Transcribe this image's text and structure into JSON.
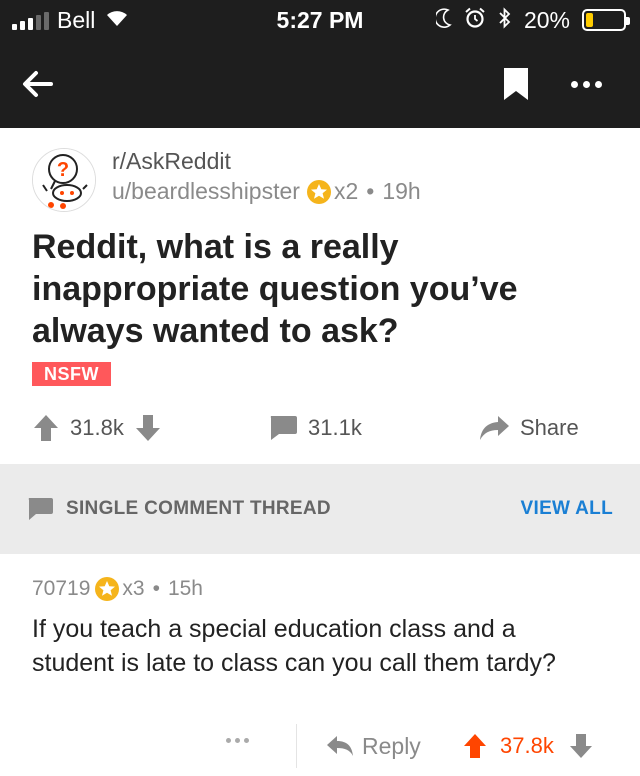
{
  "status_bar": {
    "carrier": "Bell",
    "time": "5:27 PM",
    "battery_percent": "20%",
    "battery_level": 0.2,
    "signal_bars_filled": 3,
    "icons": [
      "wifi-icon",
      "moon-icon",
      "alarm-icon",
      "bluetooth-icon",
      "battery-icon"
    ]
  },
  "nav": {
    "icons": [
      "back-arrow-icon",
      "bookmark-icon",
      "more-icon"
    ]
  },
  "post": {
    "subreddit": "r/AskReddit",
    "author": "u/beardlesshipster",
    "award_count": "x2",
    "separator": "•",
    "age": "19h",
    "title": "Reddit, what is a really inappropriate question you’ve always wanted to ask?",
    "nsfw_label": "NSFW",
    "upvotes": "31.8k",
    "comments": "31.1k",
    "share_label": "Share"
  },
  "thread_banner": {
    "label": "SINGLE COMMENT THREAD",
    "view_all": "VIEW ALL"
  },
  "comment": {
    "author": "70719",
    "award_count": "x3",
    "separator": "•",
    "age": "15h",
    "body": "If you teach a special education class and a student is late to class can you call them tardy?",
    "reply_label": "Reply",
    "upvotes": "37.8k"
  },
  "colors": {
    "header_bg": "#1e1e1e",
    "nsfw": "#ff585b",
    "link_blue": "#1a7fd4",
    "upvote_orange": "#ff4500",
    "award_gold": "#f5b41b",
    "banner_bg": "#ebebeb"
  }
}
